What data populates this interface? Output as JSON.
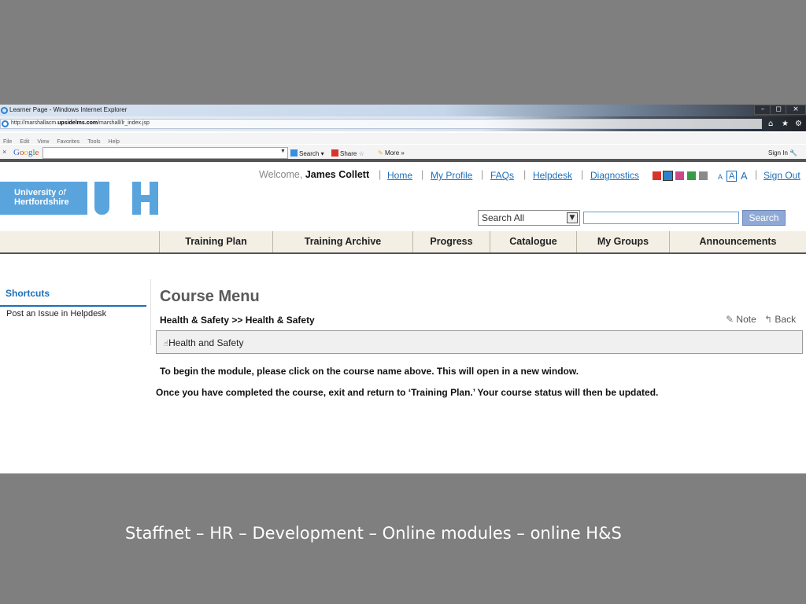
{
  "browser": {
    "window_title": "Learner Page - Windows Internet Explorer",
    "url_prefix": "http://marshallacm.",
    "url_domain": "upsidelms.com",
    "url_path": "/marshall/lr_index.jsp",
    "window_buttons": [
      "–",
      "◻",
      "×"
    ],
    "nav_icons": [
      "⌂",
      "★",
      "⚙"
    ],
    "menu": [
      "File",
      "Edit",
      "View",
      "Favorites",
      "Tools",
      "Help"
    ],
    "google_toolbar": {
      "close": "×",
      "logo": "Google",
      "search_label": "Search",
      "share_label": "Share",
      "more_label": "More »",
      "signin_label": "Sign In"
    }
  },
  "header": {
    "welcome_prefix": "Welcome,",
    "user_name": "James Collett",
    "links": {
      "home": "Home",
      "profile": "My Profile",
      "faqs": "FAQs",
      "helpdesk": "Helpdesk",
      "diagnostics": "Diagnostics",
      "signout": "Sign Out"
    },
    "font_sizes": [
      "A",
      "A",
      "A"
    ],
    "theme_colors": [
      "#d9342b",
      "#2e82c9",
      "#c94a8a",
      "#3b9a46",
      "#8a8a8a"
    ]
  },
  "logo": {
    "line1": "University",
    "line1_of": "of",
    "line2": "Hertfordshire"
  },
  "search": {
    "scope": "Search All",
    "button": "Search"
  },
  "nav": {
    "tabs": [
      "Training Plan",
      "Training Archive",
      "Progress",
      "Catalogue",
      "My Groups",
      "Announcements"
    ]
  },
  "sidebar": {
    "title": "Shortcuts",
    "items": [
      "Post an Issue in Helpdesk"
    ]
  },
  "main": {
    "title": "Course Menu",
    "breadcrumb": "Health & Safety >> Health & Safety",
    "note": "Note",
    "back": "Back",
    "course_name": "Health and Safety",
    "instruction_1": "To begin the module, please click on the course name above. This will open in a new window.",
    "instruction_2": "Once you have completed the course, exit and return to ‘Training Plan.’ Your course status will then be updated."
  },
  "caption": "Staffnet – HR – Development – Online modules – online H&S"
}
